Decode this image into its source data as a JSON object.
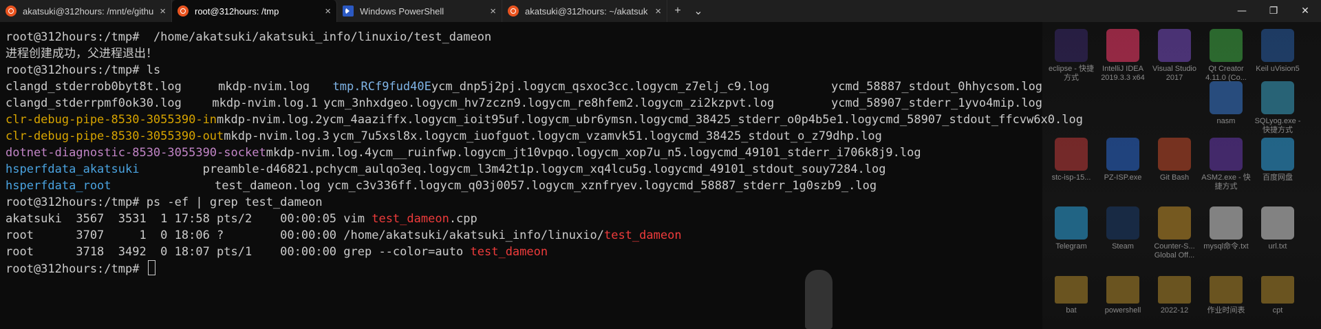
{
  "tabs": [
    {
      "title": "akatsuki@312hours: /mnt/e/githu",
      "icon": "ubuntu-icon"
    },
    {
      "title": "root@312hours: /tmp",
      "icon": "ubuntu-icon",
      "active": true
    },
    {
      "title": "Windows PowerShell",
      "icon": "powershell-icon"
    },
    {
      "title": "akatsuki@312hours: ~/akatsuk",
      "icon": "ubuntu-icon"
    }
  ],
  "tabbar": {
    "new_tab": "+",
    "dropdown": "⌄",
    "close": "×"
  },
  "window_controls": {
    "minimize": "—",
    "maximize": "❐",
    "close": "✕"
  },
  "colors": {
    "background": "#0c0c0c",
    "text": "#cccccc",
    "yellow": "#d7a400",
    "magenta": "#c285c7",
    "blue": "#4aa3e0",
    "red": "#ee3b3b"
  },
  "terminal": {
    "line1_prompt": "root@312hours:/tmp# ",
    "line1_cmd": " /home/akatsuki/akatsuki_info/linuxio/test_dameon",
    "line2": "进程创建成功，父进程退出！",
    "line3_prompt": "root@312hours:/tmp# ",
    "line3_cmd": "ls",
    "ls_rows": [
      [
        "clangd_stderrob0byt8t.log",
        "mkdp-nvim.log",
        "tmp.RCf9fud40E",
        "ycm_dnp5j2pj.log",
        "ycm_qsxoc3cc.log",
        "ycm_z7elj_c9.log",
        "ycmd_58887_stdout_0hhycsom.log"
      ],
      [
        "clangd_stderrpmf0ok30.log",
        "mkdp-nvim.log.1",
        "ycm_3nhxdgeo.log",
        "ycm_hv7zczn9.log",
        "ycm_re8hfem2.log",
        "ycm_zi2kzpvt.log",
        "ycmd_58907_stderr_1yvo4mip.log"
      ],
      [
        "clr-debug-pipe-8530-3055390-in",
        "mkdp-nvim.log.2",
        "ycm_4aaziffx.log",
        "ycm_ioit95uf.log",
        "ycm_ubr6ymsn.log",
        "ycmd_38425_stderr_o0p4b5e1.log",
        "ycmd_58907_stdout_ffcvw6x0.log"
      ],
      [
        "clr-debug-pipe-8530-3055390-out",
        "mkdp-nvim.log.3",
        "ycm_7u5xsl8x.log",
        "ycm_iuofguot.log",
        "ycm_vzamvk51.log",
        "ycmd_38425_stdout_o_z79dhp.log",
        ""
      ],
      [
        "dotnet-diagnostic-8530-3055390-socket",
        "mkdp-nvim.log.4",
        "ycm__ruinfwp.log",
        "ycm_jt10vpqo.log",
        "ycm_xop7u_n5.log",
        "ycmd_49101_stderr_i706k8j9.log",
        ""
      ],
      [
        "hsperfdata_akatsuki",
        "preamble-d46821.pch",
        "ycm_aulqo3eq.log",
        "ycm_l3m42t1p.log",
        "ycm_xq4lcu5g.log",
        "ycmd_49101_stdout_souy7284.log",
        ""
      ],
      [
        "hsperfdata_root",
        "test_dameon.log",
        "ycm_c3v336ff.log",
        "ycm_q03j0057.log",
        "ycm_xznfryev.log",
        "ycmd_58887_stderr_1g0szb9_.log",
        ""
      ]
    ],
    "ps_prompt": "root@312hours:/tmp# ",
    "ps_cmd": "ps -ef | grep test_dameon",
    "ps1_pre": "akatsuki  3567  3531  1 17:58 pts/2    00:00:05 vim ",
    "ps1_match": "test_dameon",
    "ps1_post": ".cpp",
    "ps2_pre": "root      3707     1  0 18:06 ?        00:00:00 /home/akatsuki/akatsuki_info/linuxio/",
    "ps2_match": "test_dameon",
    "ps3_pre": "root      3718  3492  0 18:07 pts/1    00:00:00 grep --color=auto ",
    "ps3_match": "test_dameon",
    "last_prompt": "root@312hours:/tmp# "
  },
  "desktop_icons": [
    {
      "label": "eclipse - 快捷方式",
      "icon": "eclipse-icon"
    },
    {
      "label": "IntelliJ IDEA 2019.3.3 x64",
      "icon": "intellij-icon"
    },
    {
      "label": "Visual Studio 2017",
      "icon": "visual-studio-icon"
    },
    {
      "label": "Qt Creator 4.11.0 (Co...",
      "icon": "qt-icon"
    },
    {
      "label": "Keil uVision5",
      "icon": "keil-icon"
    },
    {
      "label": "nasm",
      "icon": "nasm-icon"
    },
    {
      "label": "SQLyog.exe - 快捷方式",
      "icon": "sqlyog-icon"
    },
    {
      "label": "stc-isp-15...",
      "icon": "stc-isp-icon"
    },
    {
      "label": "PZ-ISP.exe",
      "icon": "pz-isp-icon"
    },
    {
      "label": "Git Bash",
      "icon": "git-bash-icon"
    },
    {
      "label": "ASM2.exe - 快捷方式",
      "icon": "asm2-icon"
    },
    {
      "label": "百度网盘",
      "icon": "baidu-netdisk-icon"
    },
    {
      "label": "Telegram",
      "icon": "telegram-icon"
    },
    {
      "label": "Steam",
      "icon": "steam-icon"
    },
    {
      "label": "Counter-S... Global Off...",
      "icon": "csgo-icon"
    },
    {
      "label": "mysql命令.txt",
      "icon": "text-file-icon"
    },
    {
      "label": "url.txt",
      "icon": "text-file-icon"
    },
    {
      "label": "bat",
      "icon": "folder-icon"
    },
    {
      "label": "powershell",
      "icon": "folder-icon"
    },
    {
      "label": "2022-12",
      "icon": "folder-icon"
    },
    {
      "label": "作业时间表",
      "icon": "folder-icon"
    },
    {
      "label": "cpt",
      "icon": "folder-icon"
    }
  ]
}
